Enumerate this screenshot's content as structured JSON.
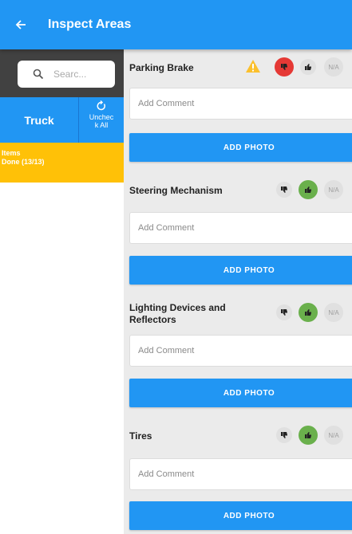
{
  "appbar": {
    "title": "Inspect Areas",
    "back_icon": "arrow-left-icon"
  },
  "sidebar": {
    "search_placeholder": "Searc...",
    "tab_label": "Truck",
    "uncheck_label": "Unchec k All",
    "status_title": "Items",
    "status_subtitle": "Done (13/13)"
  },
  "colors": {
    "primary": "#2196f3",
    "status": "#ffc107",
    "fail": "#e53935",
    "pass": "#6ab04c",
    "warning": "#fbc02d"
  },
  "items": [
    {
      "title": "Parking Brake",
      "comment_placeholder": "Add Comment",
      "photo_label": "ADD PHOTO",
      "na_label": "N/A",
      "selected": "fail",
      "warning": true
    },
    {
      "title": "Steering Mechanism",
      "comment_placeholder": "Add Comment",
      "photo_label": "ADD PHOTO",
      "na_label": "N/A",
      "selected": "pass",
      "warning": false
    },
    {
      "title": "Lighting Devices and Reflectors",
      "comment_placeholder": "Add Comment",
      "photo_label": "ADD PHOTO",
      "na_label": "N/A",
      "selected": "pass",
      "warning": false
    },
    {
      "title": "Tires",
      "comment_placeholder": "Add Comment",
      "photo_label": "ADD PHOTO",
      "na_label": "N/A",
      "selected": "pass",
      "warning": false
    }
  ]
}
